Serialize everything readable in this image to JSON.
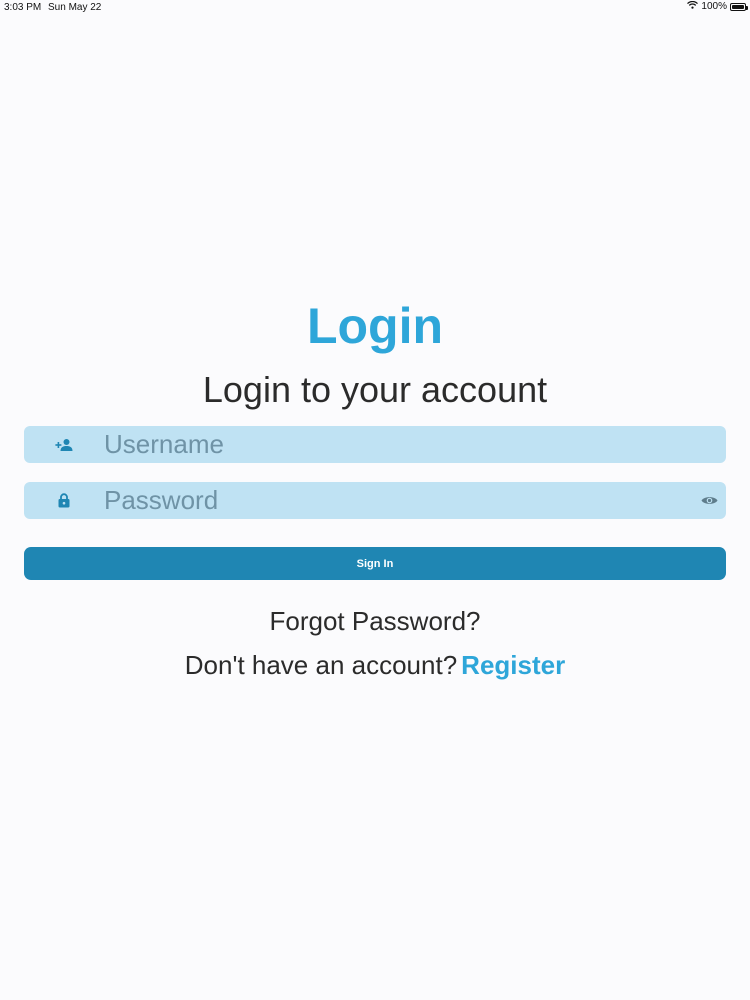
{
  "status_bar": {
    "time": "3:03 PM",
    "date": "Sun May 22",
    "battery": "100%",
    "battery_level": 1.0
  },
  "login": {
    "title": "Login",
    "subtitle": "Login to your account",
    "username": {
      "placeholder": "Username",
      "value": "",
      "icon": "person-add-icon"
    },
    "password": {
      "placeholder": "Password",
      "value": "",
      "icon": "lock-icon",
      "toggle_icon": "eye-icon"
    },
    "sign_in_label": "Sign In",
    "forgot_password": "Forgot Password?",
    "no_account_text": "Don't have an account?",
    "register_label": "Register"
  },
  "colors": {
    "accent": "#2ea6d9",
    "button": "#1f86b3",
    "field_bg": "#bfe2f3",
    "icon": "#1f86b3",
    "placeholder": "#6f93a6",
    "background": "#fbfbfd"
  }
}
